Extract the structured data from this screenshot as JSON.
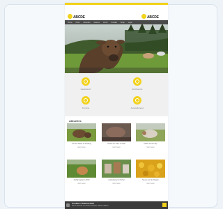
{
  "header": {
    "logo_left": {
      "name": "ABCDE",
      "sub": "schweiz"
    },
    "logo_right": {
      "name": "ABCDE",
      "sub": "schweiz"
    }
  },
  "nav": {
    "items": [
      "Home",
      "Kühe",
      "Aktuelles",
      "Rassen",
      "Zucht",
      "Kontakt",
      "Shop",
      "Login"
    ]
  },
  "features": [
    {
      "label": "Herdebuch",
      "icon": "book-icon"
    },
    {
      "label": "Zuchtwerte",
      "icon": "chart-icon"
    },
    {
      "label": "Termine",
      "icon": "calendar-icon"
    },
    {
      "label": "Ausstellungen",
      "icon": "trophy-icon"
    }
  ],
  "news": {
    "title": "Aktuelles",
    "items": [
      {
        "caption": "Auf der Weide im Frühling",
        "more": "mehr lesen"
      },
      {
        "caption": "Schau der Kühe im Stall",
        "more": "mehr lesen"
      },
      {
        "caption": "Kälber auf der Alp",
        "more": "mehr lesen"
      },
      {
        "caption": "Zuchtprogramm 2024",
        "more": "mehr lesen"
      },
      {
        "caption": "Ausstellung im Herbst",
        "more": "mehr lesen"
      },
      {
        "caption": "Neues aus der Region",
        "more": "mehr lesen"
      }
    ]
  },
  "cookie": {
    "title": "Cookies / Datenschutz",
    "text": "Diese Website verwendet Cookies. Mehr erfahren"
  },
  "colors": {
    "accent": "#f2d21b",
    "nav": "#4a4a4a"
  }
}
